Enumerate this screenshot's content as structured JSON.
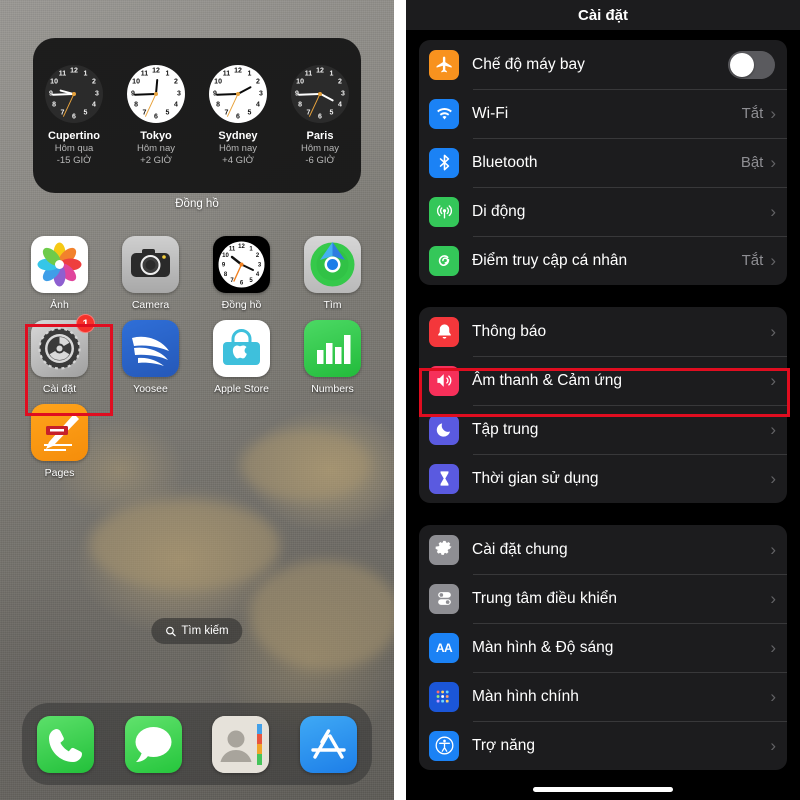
{
  "home": {
    "widget": {
      "label": "Đồng hồ",
      "clocks": [
        {
          "city": "Cupertino",
          "day": "Hôm qua",
          "offset": "-15 GIỜ",
          "face": "dark",
          "hour_deg": 285,
          "min_deg": 268,
          "sec_deg": 205
        },
        {
          "city": "Tokyo",
          "day": "Hôm nay",
          "offset": "+2 GIỜ",
          "face": "light",
          "hour_deg": 5,
          "min_deg": 268,
          "sec_deg": 205
        },
        {
          "city": "Sydney",
          "day": "Hôm nay",
          "offset": "+4 GIỜ",
          "face": "light",
          "hour_deg": 62,
          "min_deg": 268,
          "sec_deg": 205
        },
        {
          "city": "Paris",
          "day": "Hôm nay",
          "offset": "-6 GIỜ",
          "face": "dark",
          "hour_deg": 118,
          "min_deg": 268,
          "sec_deg": 205
        }
      ]
    },
    "apps": [
      [
        {
          "name": "Ảnh",
          "icon": "photos-icon",
          "badge": null
        },
        {
          "name": "Camera",
          "icon": "camera-icon",
          "badge": null
        },
        {
          "name": "Đồng hồ",
          "icon": "clock-icon",
          "badge": null
        },
        {
          "name": "Tìm",
          "icon": "find-my-icon",
          "badge": null
        }
      ],
      [
        {
          "name": "Cài đặt",
          "icon": "settings-icon",
          "badge": "1"
        },
        {
          "name": "Yoosee",
          "icon": "yoosee-icon",
          "badge": null
        },
        {
          "name": "Apple Store",
          "icon": "apple-store-icon",
          "badge": null
        },
        {
          "name": "Numbers",
          "icon": "numbers-icon",
          "badge": null
        }
      ],
      [
        {
          "name": "Pages",
          "icon": "pages-icon",
          "badge": null
        }
      ]
    ],
    "search": {
      "label": "Tìm kiếm",
      "icon": "search-icon"
    },
    "dock": [
      {
        "name": "Phone",
        "icon": "phone-icon"
      },
      {
        "name": "Messages",
        "icon": "messages-icon"
      },
      {
        "name": "Contacts",
        "icon": "contacts-icon"
      },
      {
        "name": "App Store",
        "icon": "app-store-icon"
      }
    ]
  },
  "settings": {
    "title": "Cài đặt",
    "groups": [
      {
        "rows": [
          {
            "label": "Chế độ máy bay",
            "icon": "airplane-icon",
            "icon_color": "#f8921e",
            "control": "toggle",
            "toggle_on": false,
            "value": ""
          },
          {
            "label": "Wi-Fi",
            "icon": "wifi-icon",
            "icon_color": "#1b82f5",
            "control": "chevron",
            "value": "Tắt"
          },
          {
            "label": "Bluetooth",
            "icon": "bluetooth-icon",
            "icon_color": "#1b82f5",
            "control": "chevron",
            "value": "Bật"
          },
          {
            "label": "Di động",
            "icon": "cellular-icon",
            "icon_color": "#34c759",
            "control": "chevron",
            "value": ""
          },
          {
            "label": "Điểm truy cập cá nhân",
            "icon": "hotspot-icon",
            "icon_color": "#34c759",
            "control": "chevron",
            "value": "Tắt"
          }
        ]
      },
      {
        "rows": [
          {
            "label": "Thông báo",
            "icon": "bell-icon",
            "icon_color": "#f4373b",
            "control": "chevron",
            "value": ""
          },
          {
            "label": "Âm thanh & Cảm ứng",
            "icon": "speaker-icon",
            "icon_color": "#f6305a",
            "control": "chevron",
            "value": "",
            "highlighted": true
          },
          {
            "label": "Tập trung",
            "icon": "moon-icon",
            "icon_color": "#5a5ae0",
            "control": "chevron",
            "value": ""
          },
          {
            "label": "Thời gian sử dụng",
            "icon": "hourglass-icon",
            "icon_color": "#5a5ae0",
            "control": "chevron",
            "value": ""
          }
        ]
      },
      {
        "rows": [
          {
            "label": "Cài đặt chung",
            "icon": "gear-icon",
            "icon_color": "#8e8e93",
            "control": "chevron",
            "value": ""
          },
          {
            "label": "Trung tâm điều khiển",
            "icon": "control-center-icon",
            "icon_color": "#8e8e93",
            "control": "chevron",
            "value": ""
          },
          {
            "label": "Màn hình & Độ sáng",
            "icon": "display-aa-icon",
            "icon_color": "#1b82f5",
            "control": "chevron",
            "value": ""
          },
          {
            "label": "Màn hình chính",
            "icon": "home-screen-icon",
            "icon_color": "#1b56d8",
            "control": "chevron",
            "value": ""
          },
          {
            "label": "Trợ năng",
            "icon": "accessibility-icon",
            "icon_color": "#1b82f5",
            "control": "chevron",
            "value": ""
          }
        ]
      }
    ]
  },
  "annotations": {
    "highlight_color": "#e00d20",
    "boxes": [
      {
        "name": "settings-app-highlight",
        "target": "Cài đặt"
      },
      {
        "name": "sound-row-highlight",
        "target": "Âm thanh & Cảm ứng"
      }
    ]
  }
}
